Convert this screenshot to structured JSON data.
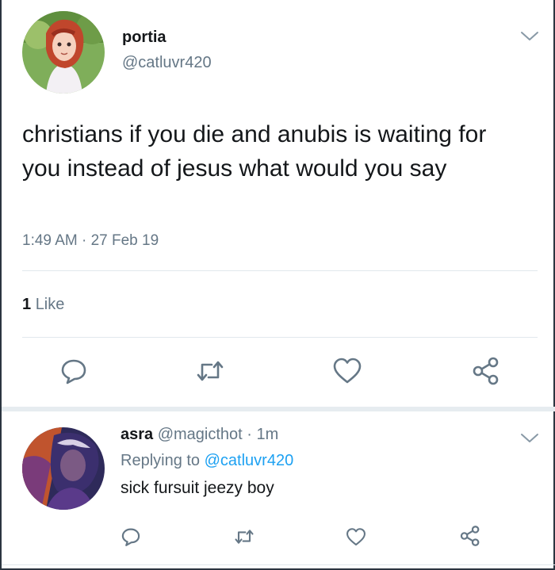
{
  "tweet": {
    "author_name": "portia",
    "author_handle": "@catluvr420",
    "text": "christians if you die and anubis is waiting for you instead of jesus what would you say",
    "timestamp": "1:49 AM · 27 Feb 19",
    "like_count": "1",
    "like_label": "Like",
    "icons": [
      "reply-icon",
      "retweet-icon",
      "like-icon",
      "share-icon",
      "chevron-down-icon"
    ]
  },
  "reply": {
    "author_name": "asra",
    "author_handle": "@magicthot",
    "separator": " · ",
    "age": "1m",
    "replying_prefix": "Replying to ",
    "replying_to": "@catluvr420",
    "text": "sick fursuit jeezy boy"
  },
  "colors": {
    "text_primary": "#14171a",
    "text_secondary": "#657786",
    "link": "#1da1f2",
    "divider": "#e1e8ed",
    "icon": "#657786"
  }
}
